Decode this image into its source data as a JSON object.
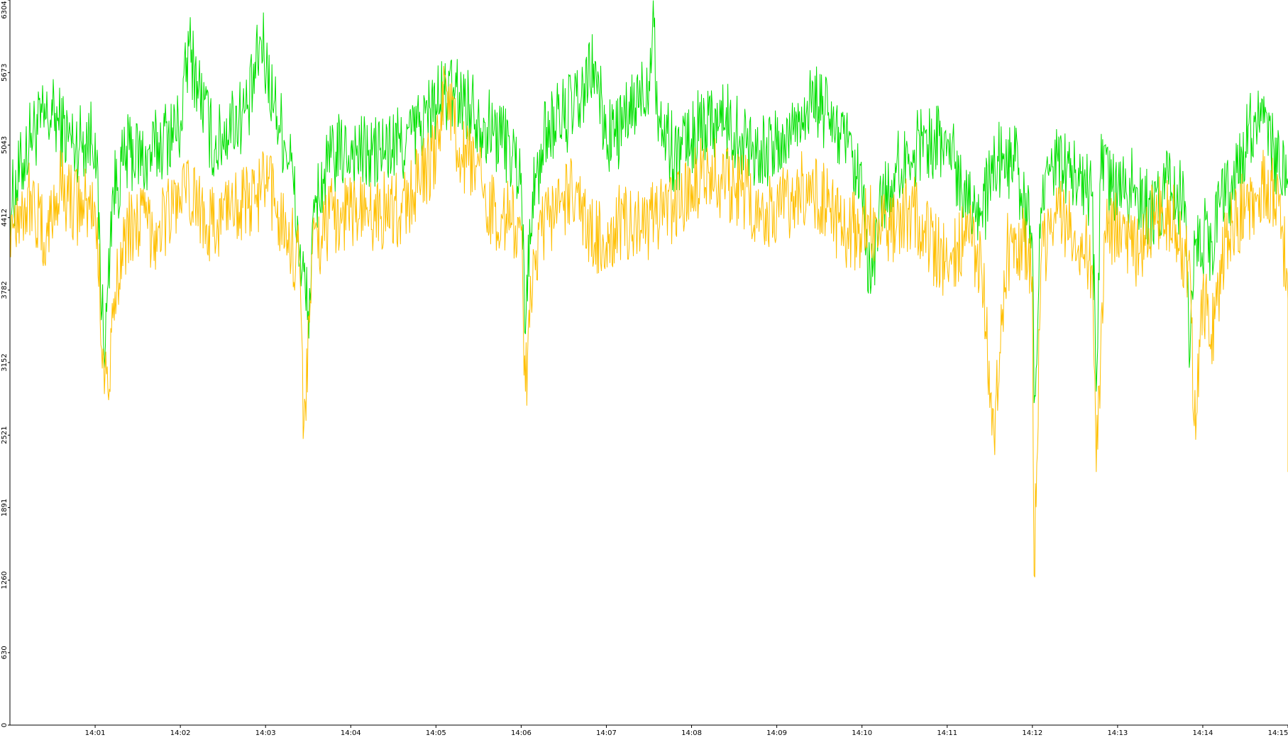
{
  "chart_data": {
    "type": "line",
    "title": "",
    "xlabel": "",
    "ylabel": "",
    "x_ticks": [
      "14:01",
      "14:02",
      "14:03",
      "14:04",
      "14:05",
      "14:06",
      "14:07",
      "14:08",
      "14:09",
      "14:10",
      "14:11",
      "14:12",
      "14:13",
      "14:14",
      "14:15"
    ],
    "x_range_minutes": [
      "14:00:00",
      "14:15:00"
    ],
    "y_ticks": [
      "0",
      "630",
      "1260",
      "1891",
      "2521",
      "3152",
      "3782",
      "4412",
      "5043",
      "5673",
      "6304"
    ],
    "ylim": [
      0,
      6304
    ],
    "grid": false,
    "legend": "none",
    "series": [
      {
        "color": "#00e000",
        "points": [
          [
            0.0,
            4500
          ],
          [
            0.25,
            5150
          ],
          [
            0.5,
            5300
          ],
          [
            0.75,
            5050
          ],
          [
            1.0,
            5150
          ],
          [
            1.08,
            3600
          ],
          [
            1.12,
            3300
          ],
          [
            1.2,
            4600
          ],
          [
            1.4,
            5000
          ],
          [
            1.6,
            4900
          ],
          [
            1.8,
            5100
          ],
          [
            2.0,
            5200
          ],
          [
            2.1,
            5900
          ],
          [
            2.2,
            5600
          ],
          [
            2.4,
            5000
          ],
          [
            2.6,
            5250
          ],
          [
            2.8,
            5350
          ],
          [
            2.95,
            5950
          ],
          [
            3.1,
            5400
          ],
          [
            3.3,
            4900
          ],
          [
            3.4,
            4100
          ],
          [
            3.5,
            3600
          ],
          [
            3.6,
            4600
          ],
          [
            3.8,
            4950
          ],
          [
            4.0,
            5000
          ],
          [
            4.2,
            4950
          ],
          [
            4.4,
            5000
          ],
          [
            4.6,
            5050
          ],
          [
            4.8,
            5200
          ],
          [
            5.0,
            5400
          ],
          [
            5.2,
            5500
          ],
          [
            5.4,
            5400
          ],
          [
            5.6,
            5200
          ],
          [
            5.8,
            5100
          ],
          [
            6.0,
            4800
          ],
          [
            6.05,
            3400
          ],
          [
            6.1,
            4400
          ],
          [
            6.3,
            5200
          ],
          [
            6.5,
            5300
          ],
          [
            6.7,
            5400
          ],
          [
            6.85,
            5750
          ],
          [
            7.0,
            5100
          ],
          [
            7.2,
            5200
          ],
          [
            7.5,
            5600
          ],
          [
            7.55,
            6300
          ],
          [
            7.6,
            5300
          ],
          [
            7.8,
            4950
          ],
          [
            8.0,
            5100
          ],
          [
            8.2,
            5300
          ],
          [
            8.4,
            5250
          ],
          [
            8.6,
            5100
          ],
          [
            8.8,
            5000
          ],
          [
            9.0,
            5000
          ],
          [
            9.2,
            5200
          ],
          [
            9.4,
            5450
          ],
          [
            9.6,
            5300
          ],
          [
            9.8,
            5050
          ],
          [
            10.0,
            4600
          ],
          [
            10.1,
            3750
          ],
          [
            10.2,
            4500
          ],
          [
            10.4,
            4800
          ],
          [
            10.6,
            5000
          ],
          [
            10.8,
            5100
          ],
          [
            11.0,
            5050
          ],
          [
            11.2,
            4700
          ],
          [
            11.4,
            4450
          ],
          [
            11.6,
            4900
          ],
          [
            11.8,
            4900
          ],
          [
            12.0,
            4200
          ],
          [
            12.02,
            2800
          ],
          [
            12.1,
            4500
          ],
          [
            12.3,
            4900
          ],
          [
            12.5,
            4800
          ],
          [
            12.7,
            4600
          ],
          [
            12.75,
            2900
          ],
          [
            12.8,
            4800
          ],
          [
            13.0,
            4600
          ],
          [
            13.2,
            4700
          ],
          [
            13.4,
            4400
          ],
          [
            13.6,
            4700
          ],
          [
            13.8,
            4500
          ],
          [
            13.85,
            3200
          ],
          [
            13.9,
            4300
          ],
          [
            14.1,
            4200
          ],
          [
            14.2,
            4500
          ],
          [
            14.4,
            4800
          ],
          [
            14.6,
            5300
          ],
          [
            14.8,
            5000
          ],
          [
            15.0,
            4700
          ]
        ]
      },
      {
        "color": "#ffbf00",
        "points": [
          [
            0.0,
            4400
          ],
          [
            0.25,
            4600
          ],
          [
            0.4,
            4200
          ],
          [
            0.6,
            4700
          ],
          [
            0.8,
            4500
          ],
          [
            1.0,
            4500
          ],
          [
            1.1,
            3200
          ],
          [
            1.15,
            2900
          ],
          [
            1.3,
            4200
          ],
          [
            1.5,
            4400
          ],
          [
            1.7,
            4300
          ],
          [
            2.0,
            4600
          ],
          [
            2.2,
            4550
          ],
          [
            2.4,
            4300
          ],
          [
            2.6,
            4600
          ],
          [
            2.8,
            4500
          ],
          [
            3.0,
            4700
          ],
          [
            3.2,
            4400
          ],
          [
            3.4,
            4000
          ],
          [
            3.45,
            2600
          ],
          [
            3.55,
            4100
          ],
          [
            3.75,
            4400
          ],
          [
            4.0,
            4500
          ],
          [
            4.2,
            4400
          ],
          [
            4.4,
            4500
          ],
          [
            4.6,
            4450
          ],
          [
            4.8,
            4750
          ],
          [
            5.0,
            4900
          ],
          [
            5.1,
            5650
          ],
          [
            5.25,
            5000
          ],
          [
            5.45,
            4800
          ],
          [
            5.65,
            4500
          ],
          [
            5.85,
            4400
          ],
          [
            6.0,
            4300
          ],
          [
            6.05,
            2900
          ],
          [
            6.15,
            4100
          ],
          [
            6.4,
            4500
          ],
          [
            6.6,
            4600
          ],
          [
            6.8,
            4300
          ],
          [
            7.0,
            4200
          ],
          [
            7.2,
            4400
          ],
          [
            7.4,
            4300
          ],
          [
            7.6,
            4400
          ],
          [
            7.8,
            4500
          ],
          [
            8.0,
            4700
          ],
          [
            8.2,
            4800
          ],
          [
            8.4,
            4700
          ],
          [
            8.6,
            4650
          ],
          [
            8.8,
            4500
          ],
          [
            9.0,
            4500
          ],
          [
            9.2,
            4600
          ],
          [
            9.4,
            4700
          ],
          [
            9.6,
            4500
          ],
          [
            9.8,
            4300
          ],
          [
            10.0,
            4300
          ],
          [
            10.2,
            4400
          ],
          [
            10.4,
            4300
          ],
          [
            10.6,
            4500
          ],
          [
            10.8,
            4200
          ],
          [
            11.0,
            4000
          ],
          [
            11.2,
            4300
          ],
          [
            11.4,
            4000
          ],
          [
            11.55,
            2500
          ],
          [
            11.7,
            4100
          ],
          [
            11.9,
            4200
          ],
          [
            12.0,
            3900
          ],
          [
            12.02,
            1300
          ],
          [
            12.1,
            4000
          ],
          [
            12.3,
            4500
          ],
          [
            12.5,
            4300
          ],
          [
            12.7,
            4000
          ],
          [
            12.75,
            2200
          ],
          [
            12.85,
            4300
          ],
          [
            13.05,
            4300
          ],
          [
            13.25,
            4100
          ],
          [
            13.45,
            4500
          ],
          [
            13.65,
            4400
          ],
          [
            13.85,
            4000
          ],
          [
            13.9,
            2600
          ],
          [
            14.0,
            3800
          ],
          [
            14.1,
            3400
          ],
          [
            14.3,
            4300
          ],
          [
            14.5,
            4500
          ],
          [
            14.7,
            4700
          ],
          [
            14.9,
            4600
          ],
          [
            15.0,
            3700
          ],
          [
            15.0,
            2200
          ]
        ]
      }
    ]
  }
}
